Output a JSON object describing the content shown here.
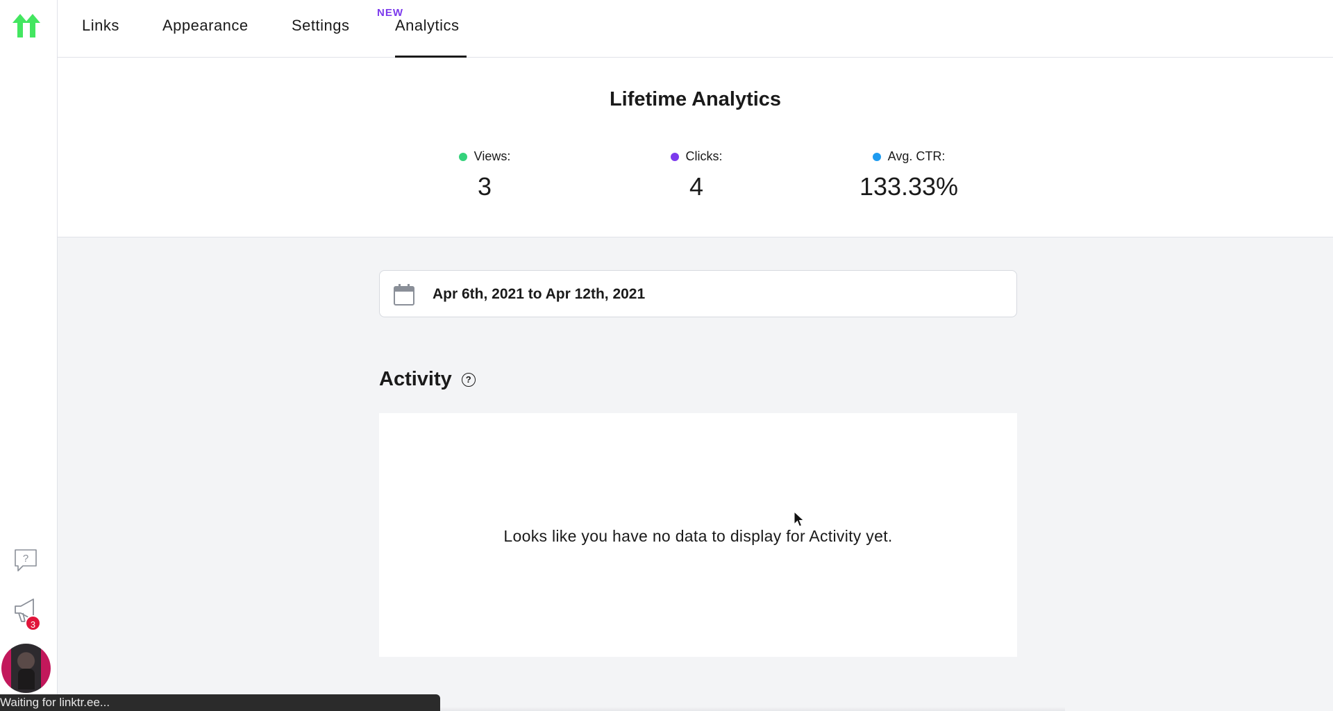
{
  "nav": {
    "tabs": [
      {
        "label": "Links"
      },
      {
        "label": "Appearance"
      },
      {
        "label": "Settings"
      },
      {
        "label": "Analytics",
        "tag": "NEW",
        "active": true
      }
    ]
  },
  "stats": {
    "title": "Lifetime Analytics",
    "items": [
      {
        "label": "Views:",
        "value": "3",
        "color": "#34d27b"
      },
      {
        "label": "Clicks:",
        "value": "4",
        "color": "#7c3aed"
      },
      {
        "label": "Avg. CTR:",
        "value": "133.33%",
        "color": "#1e9bf0"
      }
    ]
  },
  "date_range": {
    "text": "Apr 6th, 2021 to Apr 12th, 2021",
    "icon": "calendar-icon"
  },
  "activity": {
    "heading": "Activity",
    "help": "?",
    "empty_message": "Looks like you have no data to display for Activity yet."
  },
  "sidebar": {
    "notification_count": "3",
    "icons": [
      "linktree-logo",
      "help-chat-icon",
      "megaphone-icon",
      "avatar"
    ]
  },
  "status_bar": {
    "text": "Waiting for linktr.ee..."
  },
  "colors": {
    "accent_green": "#43e660",
    "badge_red": "#e0153a",
    "new_tag": "#7c3aed"
  }
}
